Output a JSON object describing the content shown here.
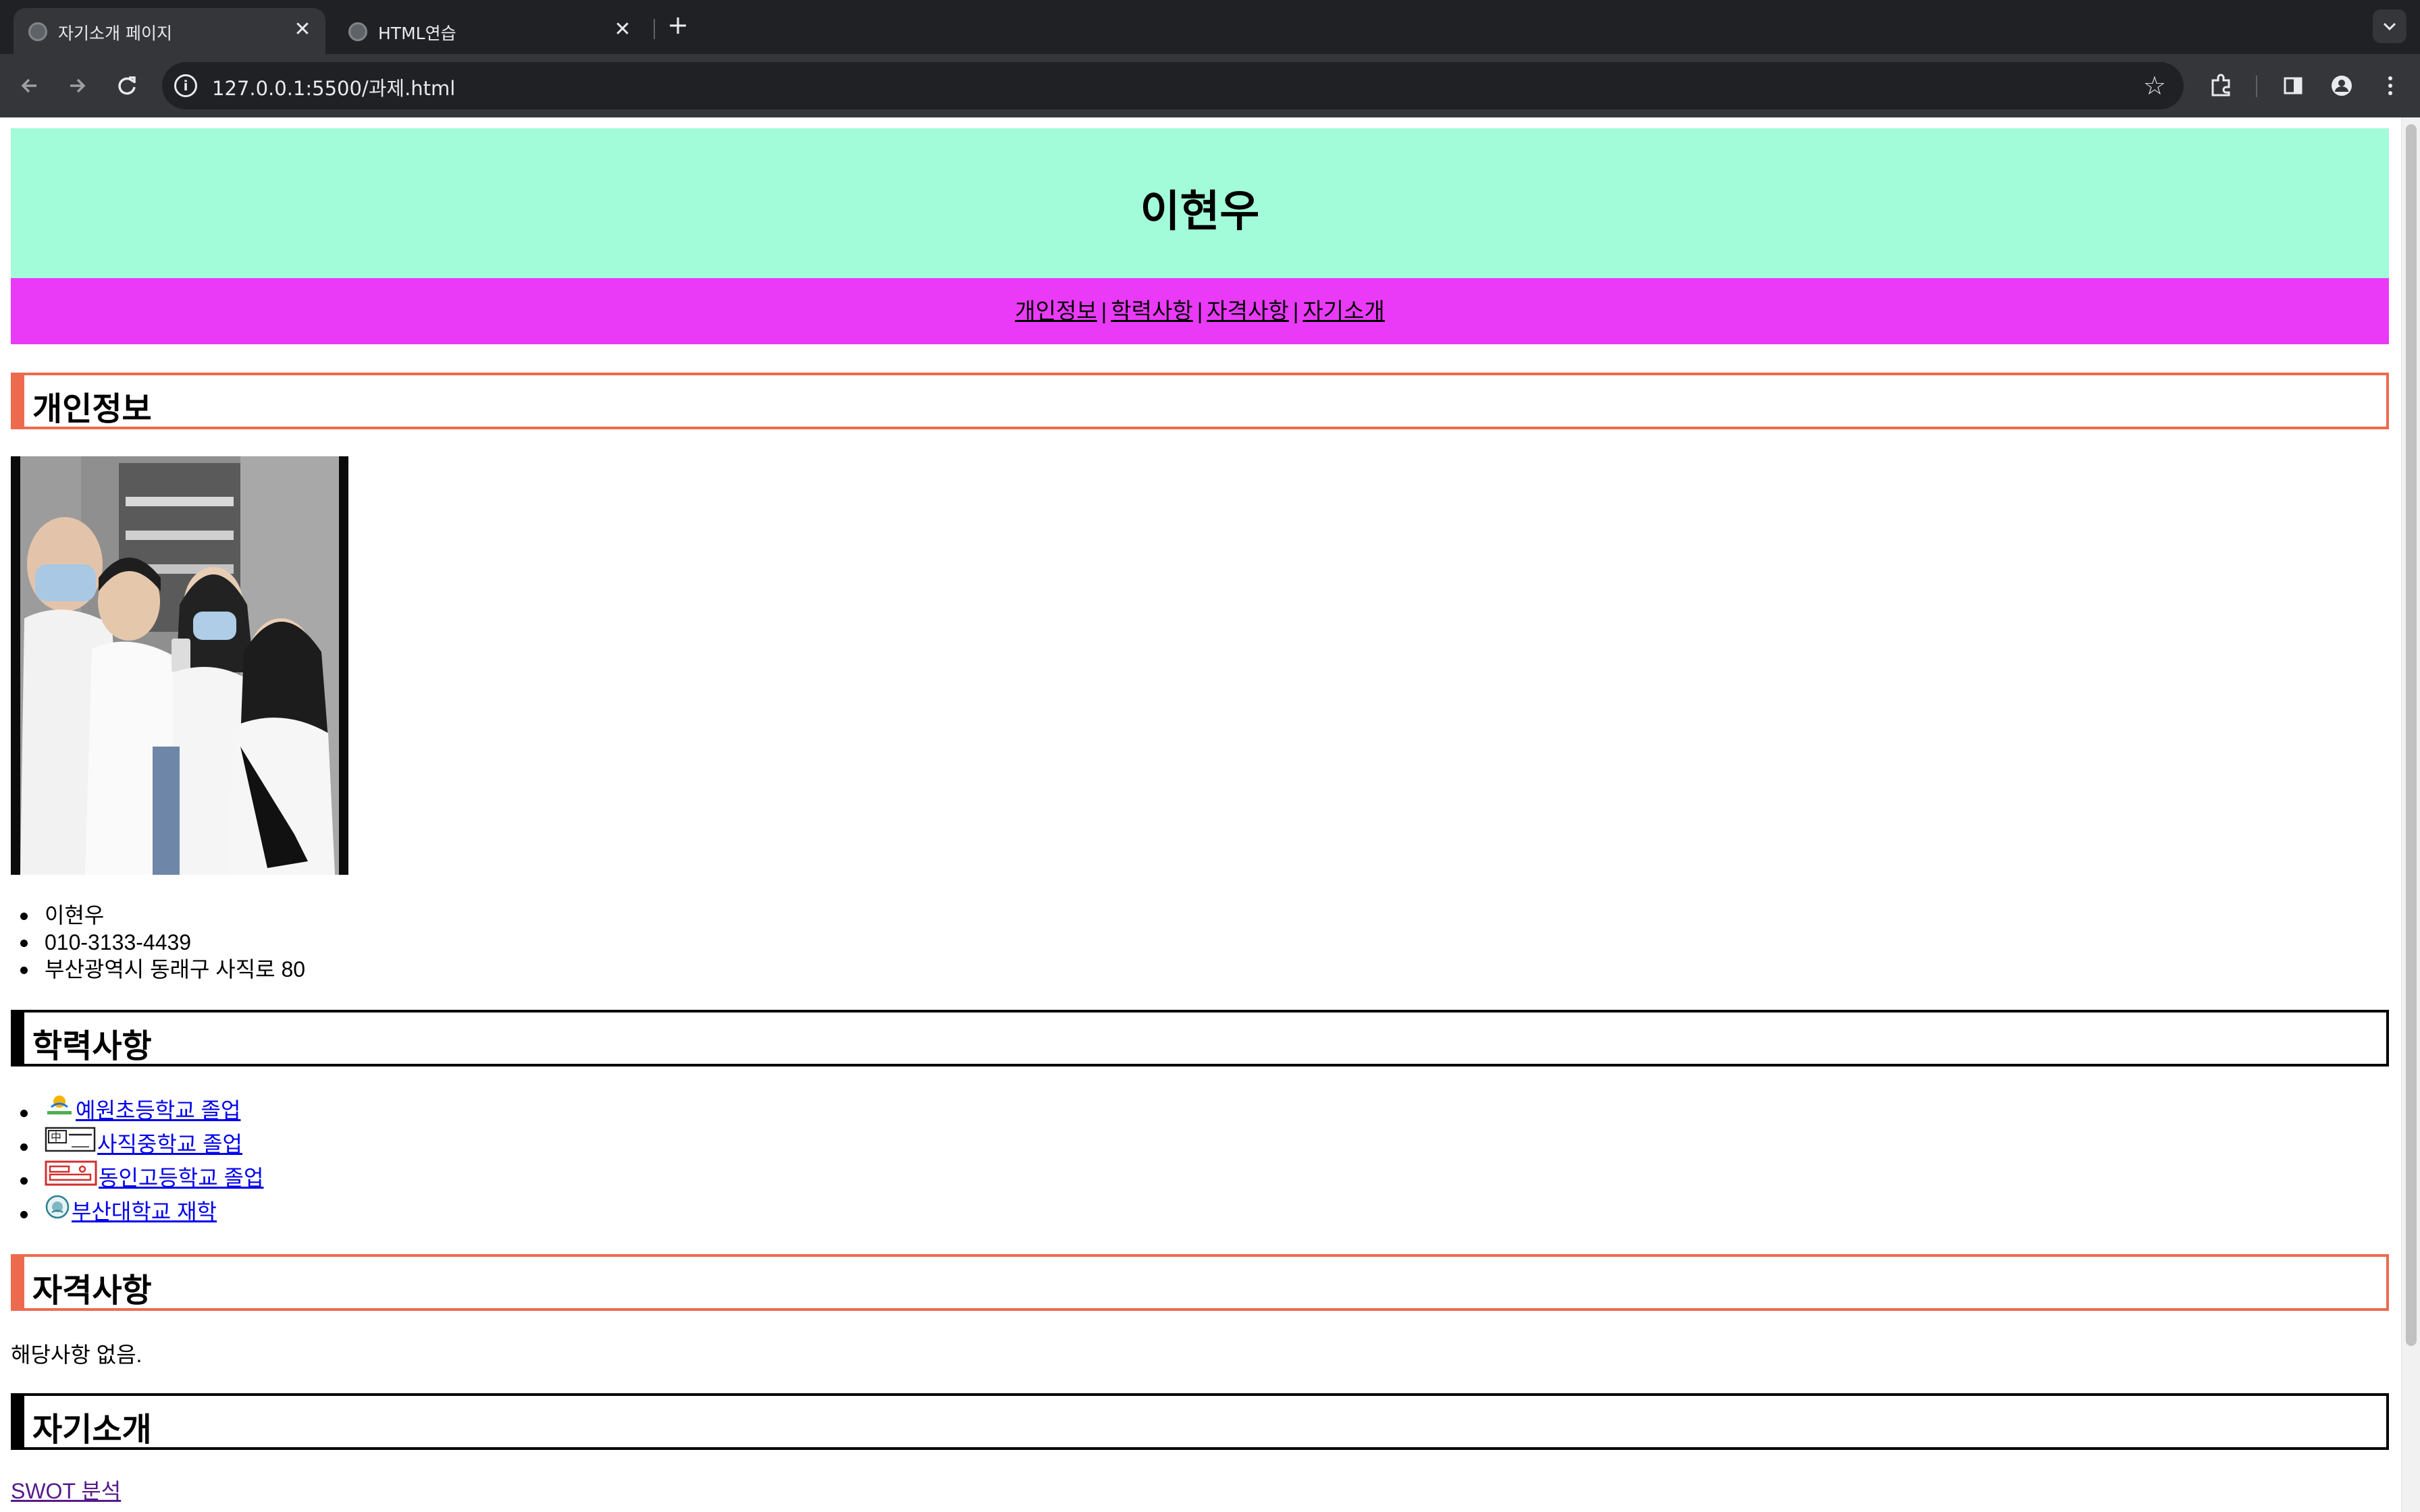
{
  "browser": {
    "tabs": [
      {
        "title": "자기소개 페이지",
        "active": true
      },
      {
        "title": "HTML연습",
        "active": false
      }
    ],
    "close_glyph": "✕",
    "new_tab_glyph": "+",
    "url": "127.0.0.1:5500/과제.html",
    "icons": [
      "back-icon",
      "forward-icon",
      "reload-icon",
      "site-info-icon",
      "bookmark-star-icon",
      "extensions-icon",
      "side-panel-icon",
      "profile-icon",
      "more-menu-icon",
      "tab-search-icon"
    ]
  },
  "page": {
    "header_title": "이현우",
    "nav": {
      "links": [
        "개인정보",
        "학력사항",
        "자격사항",
        "자기소개"
      ],
      "separator": "|"
    },
    "colors": {
      "header_bg": "#a3fcd9",
      "nav_bg": "#ea3af8",
      "orange_border": "#ee6a4f",
      "black_border": "#000000"
    },
    "sections": {
      "personal": {
        "heading": "개인정보",
        "items": [
          "이현우",
          "010-3133-4439",
          "부산광역시 동래구 사직로 80"
        ]
      },
      "education": {
        "heading": "학력사항",
        "schools": [
          {
            "name": "예원초등학교 졸업",
            "logo": "elementary-school-logo-icon"
          },
          {
            "name": "사직중학교 졸업",
            "logo": "middle-school-logo-icon"
          },
          {
            "name": "동인고등학교 졸업",
            "logo": "high-school-logo-icon"
          },
          {
            "name": "부산대학교 재학",
            "logo": "university-logo-icon"
          }
        ]
      },
      "certifications": {
        "heading": "자격사항",
        "text": "해당사항 없음."
      },
      "intro": {
        "heading": "자기소개",
        "link": "SWOT 분석"
      }
    }
  }
}
